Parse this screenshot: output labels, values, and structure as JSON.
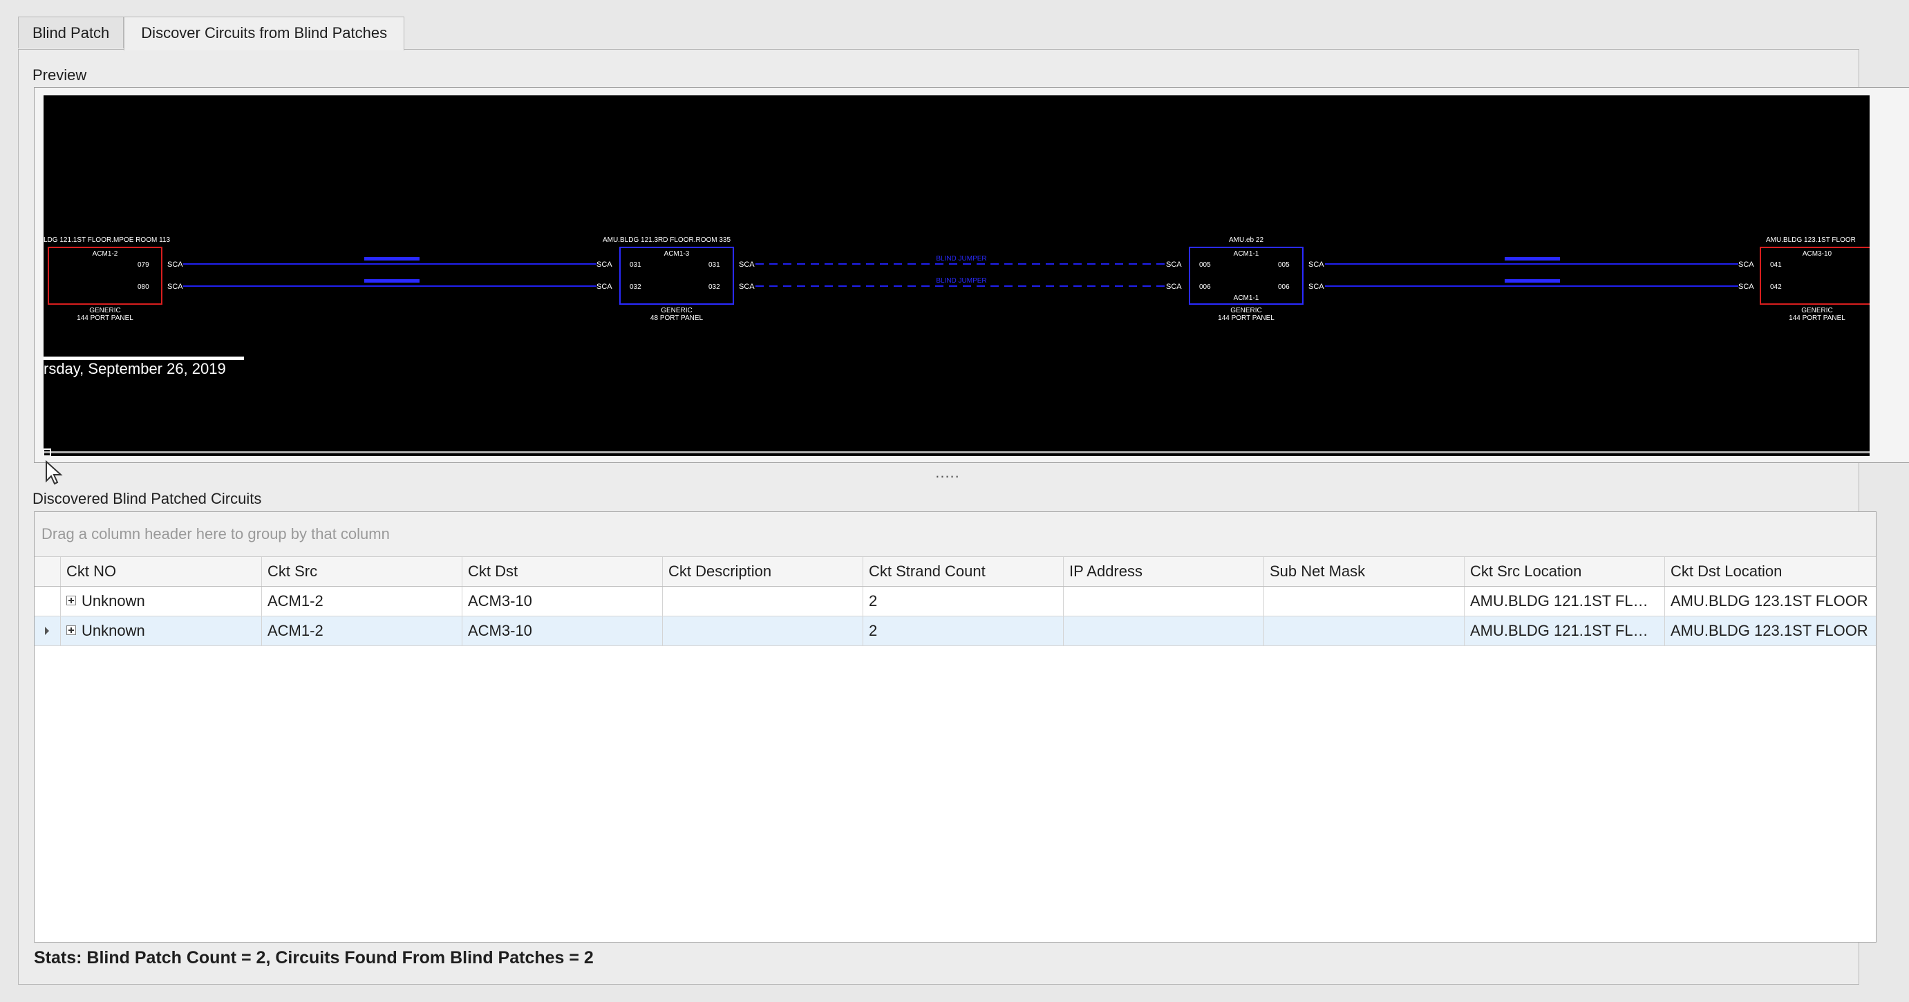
{
  "tabs": [
    {
      "label": "Blind Patch"
    },
    {
      "label": "Discover Circuits from Blind Patches"
    }
  ],
  "preview": {
    "label": "Preview",
    "splitter": ".....",
    "diagram": {
      "panels": [
        {
          "location": "LDG 121.1ST FLOOR.MPOE ROOM 113",
          "name": "ACM1-2",
          "type": "GENERIC",
          "size": "144 PORT PANEL",
          "ports_right": [
            "079",
            "080"
          ]
        },
        {
          "location": "AMU.BLDG 121.3RD FLOOR.ROOM 335",
          "name": "ACM1-3",
          "type": "GENERIC",
          "size": "48 PORT PANEL",
          "ports_left": [
            "031",
            "032"
          ],
          "ports_right": [
            "031",
            "032"
          ]
        },
        {
          "location": "AMU.eb 22",
          "name": "ACM1-1",
          "name2": "ACM1-1",
          "type": "GENERIC",
          "size": "144 PORT PANEL",
          "ports_left": [
            "005",
            "006"
          ],
          "ports_right": [
            "005",
            "006"
          ]
        },
        {
          "location": "AMU.BLDG 123.1ST FLOOR",
          "name": "ACM3-10",
          "type": "GENERIC",
          "size": "144 PORT PANEL",
          "ports_left": [
            "041",
            "042"
          ]
        }
      ],
      "connector": "SCA",
      "links": [
        "BLIND JUMPER"
      ],
      "date": "rsday, September 26, 2019"
    }
  },
  "grid": {
    "label": "Discovered Blind Patched Circuits",
    "group_hint": "Drag a column header here to group by that column",
    "columns": [
      "Ckt NO",
      "Ckt Src",
      "Ckt Dst",
      "Ckt Description",
      "Ckt Strand Count",
      "IP Address",
      "Sub Net Mask",
      "Ckt Src Location",
      "Ckt Dst Location"
    ],
    "rows": [
      {
        "ckt_no": "Unknown",
        "ckt_src": "ACM1-2",
        "ckt_dst": "ACM3-10",
        "ckt_description": "",
        "ckt_strand_count": "2",
        "ip_address": "",
        "sub_net_mask": "",
        "ckt_src_location": "AMU.BLDG 121.1ST FLOO...",
        "ckt_dst_location": "AMU.BLDG 123.1ST FLOOR"
      },
      {
        "ckt_no": "Unknown",
        "ckt_src": "ACM1-2",
        "ckt_dst": "ACM3-10",
        "ckt_description": "",
        "ckt_strand_count": "2",
        "ip_address": "",
        "sub_net_mask": "",
        "ckt_src_location": "AMU.BLDG 121.1ST FLOO...",
        "ckt_dst_location": "AMU.BLDG 123.1ST FLOOR"
      }
    ]
  },
  "stats": "Stats: Blind Patch Count = 2, Circuits Found From Blind Patches = 2",
  "colors": {
    "canvas_bg": "#000000",
    "panel_red": "#d81e1e",
    "panel_blue": "#2a2aff",
    "line_blue": "#2020ee",
    "selection": "#e5f1fb"
  }
}
